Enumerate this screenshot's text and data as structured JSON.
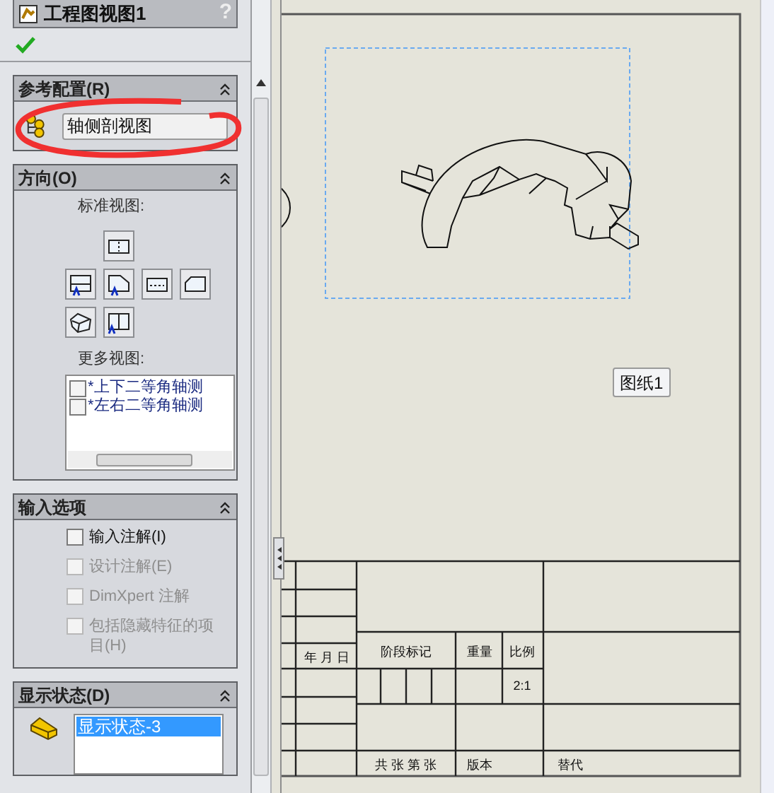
{
  "panel": {
    "title": "工程图视图1",
    "help": "?"
  },
  "sections": [
    {
      "kind": "config",
      "title": "参考配置(R)",
      "value": "轴侧剖视图"
    },
    {
      "kind": "orientation",
      "title": "方向(O)",
      "standard_label": "标准视图:",
      "more_label": "更多视图:",
      "more_views": [
        {
          "label": "*上下二等角轴测",
          "checked": false
        },
        {
          "label": "*左右二等角轴测",
          "checked": false
        }
      ]
    },
    {
      "kind": "import",
      "title": "输入选项",
      "options": [
        {
          "label": "输入注解(I)",
          "checked": false,
          "disabled": false
        },
        {
          "label": "设计注解(E)",
          "checked": false,
          "disabled": true
        },
        {
          "label": "DimXpert 注解",
          "checked": false,
          "disabled": true
        },
        {
          "label": "包括隐藏特征的项目(H)",
          "checked": false,
          "disabled": true
        }
      ]
    },
    {
      "kind": "display",
      "title": "显示状态(D)",
      "items": [
        {
          "label": "显示状态-3",
          "selected": true
        }
      ]
    }
  ],
  "sheet": {
    "tab": "图纸1",
    "title_block": {
      "date_header": "年 月 日",
      "stage_mark": "阶段标记",
      "weight": "重量",
      "scale_header": "比例",
      "scale": "2:1",
      "sheets": "共 张 第 张",
      "version": "版本",
      "replaces": "替代"
    }
  }
}
